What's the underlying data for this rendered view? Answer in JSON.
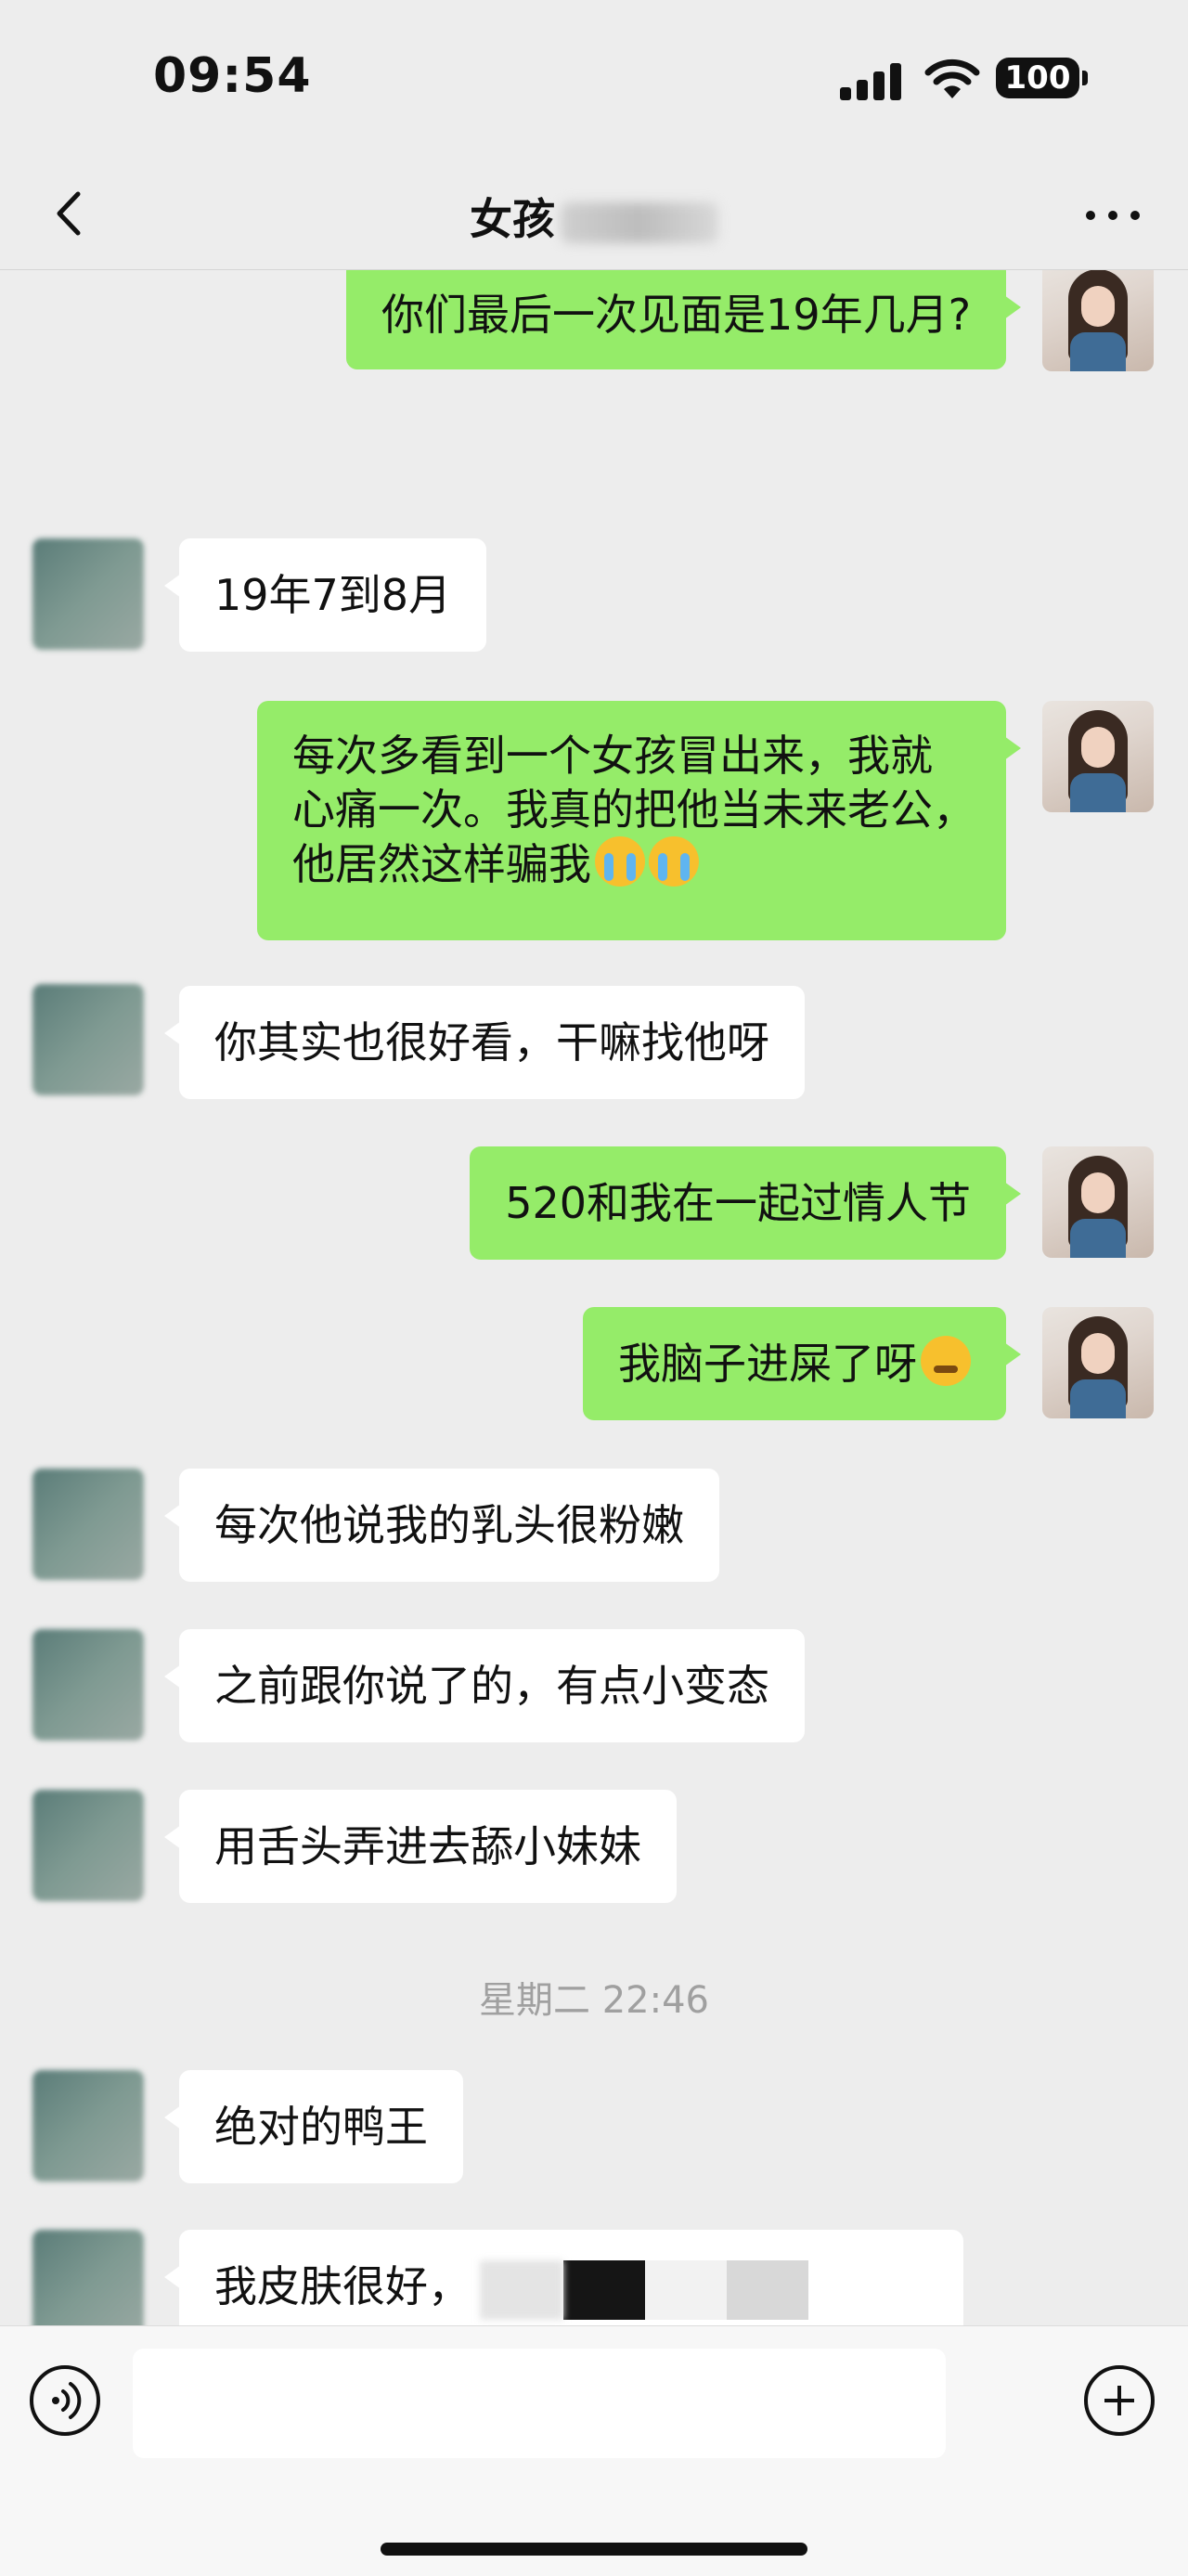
{
  "status_bar": {
    "time": "09:54",
    "battery": "100"
  },
  "nav": {
    "title": "女孩"
  },
  "messages": {
    "m1": {
      "text": "你们最后一次见面是19年几月?"
    },
    "m2": {
      "text": "19年7到8月"
    },
    "m3": {
      "line1": "每次多看到一个女孩冒出来，我就",
      "line2": "心痛一次。我真的把他当未来老公，",
      "line3": "他居然这样骗我"
    },
    "m4": {
      "text": "你其实也很好看，干嘛找他呀"
    },
    "m5": {
      "text": "520和我在一起过情人节"
    },
    "m6": {
      "text": "我脑子进屎了呀"
    },
    "m7": {
      "text": "每次他说我的乳头很粉嫩"
    },
    "m8": {
      "text": "之前跟你说了的，有点小变态"
    },
    "m9": {
      "text": "用舌头弄进去舔小妹妹"
    },
    "timestamp": "星期二 22:46",
    "m10": {
      "text": "绝对的鸭王"
    },
    "m11": {
      "text": "我皮肤很好，"
    }
  },
  "colors": {
    "self_bubble": "#95ec69",
    "other_bubble": "#ffffff",
    "background": "#ededed"
  },
  "icons": {
    "back": "chevron-left-icon",
    "more": "more-dots-icon",
    "voice": "voice-icon",
    "plus": "plus-icon",
    "emoji_cry": "crying-emoji",
    "emoji_angry": "angry-emoji"
  }
}
